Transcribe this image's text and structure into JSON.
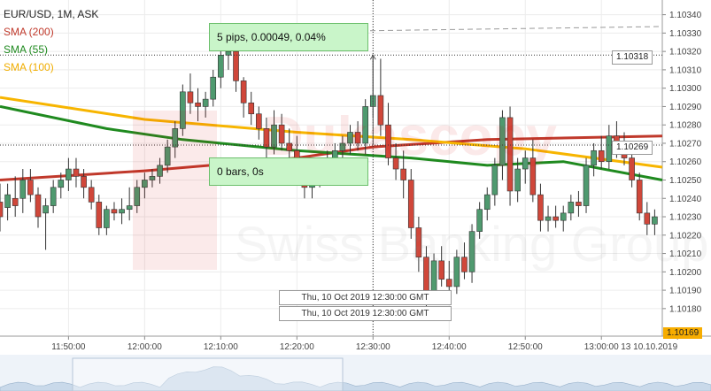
{
  "legend": {
    "instrument": "EUR/USD, 1M, ASK",
    "sma200": "SMA (200)",
    "sma55": "SMA (55)",
    "sma100": "SMA (100)"
  },
  "watermark": {
    "name": "Dukascopy",
    "sub": "Swiss Banking Group"
  },
  "measurement": {
    "top": "5 pips, 0.00049, 0.04%",
    "bottom": "0 bars, 0s"
  },
  "crosshair_time": "Thu, 10 Oct 2019 12:30:00 GMT",
  "crosshair_price": "1.10318",
  "sma_price_label": "1.10269",
  "last_price_label": "1.10169",
  "colors": {
    "bull": "#4f9a6f",
    "bear": "#d0473a",
    "sma200": "#c0392b",
    "sma55": "#1f8a1f",
    "sma100": "#f7b500"
  },
  "chart_data": {
    "type": "candlestick",
    "instrument": "EUR/USD",
    "timeframe": "1M",
    "side": "ASK",
    "x_tick_labels": [
      "11:50:00",
      "12:00:00",
      "12:10:00",
      "12:20:00",
      "12:30:00",
      "12:40:00",
      "12:50:00",
      "13:00:00",
      "13 10.10.2019"
    ],
    "y_tick_labels": [
      "1.10340",
      "1.10330",
      "1.10320",
      "1.10310",
      "1.10300",
      "1.10290",
      "1.10280",
      "1.10270",
      "1.10260",
      "1.10250",
      "1.10240",
      "1.10230",
      "1.10220",
      "1.10210",
      "1.10200",
      "1.10190",
      "1.10180"
    ],
    "ylim": [
      1.10165,
      1.10348
    ],
    "time_start": "11:41",
    "time_end": "13:08",
    "candles": [
      {
        "time": "11:41",
        "open": 1.10238,
        "high": 1.10248,
        "low": 1.10222,
        "close": 1.1023
      },
      {
        "time": "11:42",
        "open": 1.10235,
        "high": 1.10248,
        "low": 1.10228,
        "close": 1.10242
      },
      {
        "time": "11:43",
        "open": 1.1024,
        "high": 1.10252,
        "low": 1.1023,
        "close": 1.10236
      },
      {
        "time": "11:44",
        "open": 1.1024,
        "high": 1.10256,
        "low": 1.10232,
        "close": 1.1025
      },
      {
        "time": "11:45",
        "open": 1.1025,
        "high": 1.10256,
        "low": 1.10238,
        "close": 1.10242
      },
      {
        "time": "11:46",
        "open": 1.10242,
        "high": 1.10246,
        "low": 1.10224,
        "close": 1.1023
      },
      {
        "time": "11:47",
        "open": 1.10232,
        "high": 1.1024,
        "low": 1.10212,
        "close": 1.10236
      },
      {
        "time": "11:48",
        "open": 1.10236,
        "high": 1.1025,
        "low": 1.10232,
        "close": 1.10246
      },
      {
        "time": "11:49",
        "open": 1.10246,
        "high": 1.10254,
        "low": 1.1024,
        "close": 1.1025
      },
      {
        "time": "11:50",
        "open": 1.1025,
        "high": 1.10262,
        "low": 1.10244,
        "close": 1.10256
      },
      {
        "time": "11:51",
        "open": 1.10256,
        "high": 1.10262,
        "low": 1.10246,
        "close": 1.10252
      },
      {
        "time": "11:52",
        "open": 1.10252,
        "high": 1.10256,
        "low": 1.1024,
        "close": 1.10246
      },
      {
        "time": "11:53",
        "open": 1.10246,
        "high": 1.1025,
        "low": 1.10234,
        "close": 1.10238
      },
      {
        "time": "11:54",
        "open": 1.10238,
        "high": 1.10242,
        "low": 1.1022,
        "close": 1.10224
      },
      {
        "time": "11:55",
        "open": 1.10224,
        "high": 1.10236,
        "low": 1.1022,
        "close": 1.10234
      },
      {
        "time": "11:56",
        "open": 1.10234,
        "high": 1.10238,
        "low": 1.10228,
        "close": 1.10232
      },
      {
        "time": "11:57",
        "open": 1.10232,
        "high": 1.1024,
        "low": 1.10226,
        "close": 1.10234
      },
      {
        "time": "11:58",
        "open": 1.10234,
        "high": 1.10246,
        "low": 1.10228,
        "close": 1.10236
      },
      {
        "time": "11:59",
        "open": 1.10236,
        "high": 1.1025,
        "low": 1.10232,
        "close": 1.10246
      },
      {
        "time": "12:00",
        "open": 1.10246,
        "high": 1.10254,
        "low": 1.1024,
        "close": 1.1025
      },
      {
        "time": "12:01",
        "open": 1.1025,
        "high": 1.10256,
        "low": 1.10246,
        "close": 1.10252
      },
      {
        "time": "12:02",
        "open": 1.10252,
        "high": 1.10262,
        "low": 1.10248,
        "close": 1.10258
      },
      {
        "time": "12:03",
        "open": 1.10258,
        "high": 1.10272,
        "low": 1.10254,
        "close": 1.10268
      },
      {
        "time": "12:04",
        "open": 1.10268,
        "high": 1.10282,
        "low": 1.10262,
        "close": 1.10278
      },
      {
        "time": "12:05",
        "open": 1.10278,
        "high": 1.10302,
        "low": 1.10274,
        "close": 1.10298
      },
      {
        "time": "12:06",
        "open": 1.10298,
        "high": 1.10308,
        "low": 1.10286,
        "close": 1.10292
      },
      {
        "time": "12:07",
        "open": 1.10292,
        "high": 1.103,
        "low": 1.10282,
        "close": 1.1029
      },
      {
        "time": "12:08",
        "open": 1.1029,
        "high": 1.10298,
        "low": 1.10284,
        "close": 1.10294
      },
      {
        "time": "12:09",
        "open": 1.10294,
        "high": 1.1031,
        "low": 1.1029,
        "close": 1.10306
      },
      {
        "time": "12:10",
        "open": 1.10306,
        "high": 1.10324,
        "low": 1.103,
        "close": 1.10318
      },
      {
        "time": "12:11",
        "open": 1.10318,
        "high": 1.10332,
        "low": 1.1031,
        "close": 1.1032
      },
      {
        "time": "12:12",
        "open": 1.1032,
        "high": 1.10328,
        "low": 1.10298,
        "close": 1.10304
      },
      {
        "time": "12:13",
        "open": 1.10304,
        "high": 1.10306,
        "low": 1.10284,
        "close": 1.10292
      },
      {
        "time": "12:14",
        "open": 1.10292,
        "high": 1.10298,
        "low": 1.1028,
        "close": 1.10286
      },
      {
        "time": "12:15",
        "open": 1.10286,
        "high": 1.1029,
        "low": 1.10272,
        "close": 1.10278
      },
      {
        "time": "12:16",
        "open": 1.10278,
        "high": 1.10284,
        "low": 1.10262,
        "close": 1.10268
      },
      {
        "time": "12:17",
        "open": 1.10268,
        "high": 1.10288,
        "low": 1.10264,
        "close": 1.1028
      },
      {
        "time": "12:18",
        "open": 1.1028,
        "high": 1.10286,
        "low": 1.10266,
        "close": 1.1027
      },
      {
        "time": "12:19",
        "open": 1.1027,
        "high": 1.10278,
        "low": 1.1026,
        "close": 1.10266
      },
      {
        "time": "12:20",
        "open": 1.10266,
        "high": 1.10274,
        "low": 1.10248,
        "close": 1.10252
      },
      {
        "time": "12:21",
        "open": 1.10252,
        "high": 1.10256,
        "low": 1.1024,
        "close": 1.10246
      },
      {
        "time": "12:22",
        "open": 1.10246,
        "high": 1.10254,
        "low": 1.1024,
        "close": 1.1025
      },
      {
        "time": "12:23",
        "open": 1.1025,
        "high": 1.10262,
        "low": 1.10246,
        "close": 1.10258
      },
      {
        "time": "12:24",
        "open": 1.10258,
        "high": 1.10266,
        "low": 1.10252,
        "close": 1.10262
      },
      {
        "time": "12:25",
        "open": 1.10262,
        "high": 1.1027,
        "low": 1.10256,
        "close": 1.10266
      },
      {
        "time": "12:26",
        "open": 1.10266,
        "high": 1.10274,
        "low": 1.1026,
        "close": 1.1027
      },
      {
        "time": "12:27",
        "open": 1.1027,
        "high": 1.1028,
        "low": 1.10264,
        "close": 1.10276
      },
      {
        "time": "12:28",
        "open": 1.10276,
        "high": 1.10282,
        "low": 1.10266,
        "close": 1.1027
      },
      {
        "time": "12:29",
        "open": 1.1027,
        "high": 1.10294,
        "low": 1.10264,
        "close": 1.1029
      },
      {
        "time": "12:30",
        "open": 1.1029,
        "high": 1.10318,
        "low": 1.10284,
        "close": 1.10296
      },
      {
        "time": "12:31",
        "open": 1.10296,
        "high": 1.10316,
        "low": 1.10274,
        "close": 1.1028
      },
      {
        "time": "12:32",
        "open": 1.1028,
        "high": 1.10292,
        "low": 1.10258,
        "close": 1.10262
      },
      {
        "time": "12:33",
        "open": 1.10262,
        "high": 1.1027,
        "low": 1.1025,
        "close": 1.10256
      },
      {
        "time": "12:34",
        "open": 1.10256,
        "high": 1.10266,
        "low": 1.1024,
        "close": 1.1025
      },
      {
        "time": "12:35",
        "open": 1.1025,
        "high": 1.10256,
        "low": 1.10218,
        "close": 1.10224
      },
      {
        "time": "12:36",
        "open": 1.10224,
        "high": 1.1023,
        "low": 1.102,
        "close": 1.10208
      },
      {
        "time": "12:37",
        "open": 1.10208,
        "high": 1.10214,
        "low": 1.1018,
        "close": 1.10188
      },
      {
        "time": "12:38",
        "open": 1.10188,
        "high": 1.1021,
        "low": 1.10184,
        "close": 1.10206
      },
      {
        "time": "12:39",
        "open": 1.10206,
        "high": 1.10214,
        "low": 1.10192,
        "close": 1.10196
      },
      {
        "time": "12:40",
        "open": 1.10196,
        "high": 1.10206,
        "low": 1.10186,
        "close": 1.10192
      },
      {
        "time": "12:41",
        "open": 1.10192,
        "high": 1.10212,
        "low": 1.10188,
        "close": 1.10208
      },
      {
        "time": "12:42",
        "open": 1.10208,
        "high": 1.10216,
        "low": 1.10196,
        "close": 1.102
      },
      {
        "time": "12:43",
        "open": 1.102,
        "high": 1.10226,
        "low": 1.10194,
        "close": 1.10222
      },
      {
        "time": "12:44",
        "open": 1.10222,
        "high": 1.10238,
        "low": 1.10218,
        "close": 1.10234
      },
      {
        "time": "12:45",
        "open": 1.10234,
        "high": 1.10246,
        "low": 1.10228,
        "close": 1.10242
      },
      {
        "time": "12:46",
        "open": 1.10242,
        "high": 1.10262,
        "low": 1.10236,
        "close": 1.10258
      },
      {
        "time": "12:47",
        "open": 1.10258,
        "high": 1.10288,
        "low": 1.1025,
        "close": 1.10284
      },
      {
        "time": "12:48",
        "open": 1.10284,
        "high": 1.1029,
        "low": 1.10236,
        "close": 1.10244
      },
      {
        "time": "12:49",
        "open": 1.10244,
        "high": 1.10262,
        "low": 1.10238,
        "close": 1.10256
      },
      {
        "time": "12:50",
        "open": 1.10256,
        "high": 1.10266,
        "low": 1.10248,
        "close": 1.10262
      },
      {
        "time": "12:51",
        "open": 1.10262,
        "high": 1.10272,
        "low": 1.10238,
        "close": 1.10242
      },
      {
        "time": "12:52",
        "open": 1.10242,
        "high": 1.10248,
        "low": 1.10222,
        "close": 1.10228
      },
      {
        "time": "12:53",
        "open": 1.10228,
        "high": 1.10236,
        "low": 1.10222,
        "close": 1.1023
      },
      {
        "time": "12:54",
        "open": 1.1023,
        "high": 1.10236,
        "low": 1.10224,
        "close": 1.10228
      },
      {
        "time": "12:55",
        "open": 1.10228,
        "high": 1.10236,
        "low": 1.10222,
        "close": 1.10232
      },
      {
        "time": "12:56",
        "open": 1.10232,
        "high": 1.10242,
        "low": 1.10228,
        "close": 1.10238
      },
      {
        "time": "12:57",
        "open": 1.10238,
        "high": 1.10244,
        "low": 1.1023,
        "close": 1.10236
      },
      {
        "time": "12:58",
        "open": 1.10236,
        "high": 1.10262,
        "low": 1.10232,
        "close": 1.10258
      },
      {
        "time": "12:59",
        "open": 1.10258,
        "high": 1.1027,
        "low": 1.10252,
        "close": 1.10266
      },
      {
        "time": "13:00",
        "open": 1.10266,
        "high": 1.10274,
        "low": 1.10256,
        "close": 1.1026
      },
      {
        "time": "13:01",
        "open": 1.1026,
        "high": 1.1028,
        "low": 1.10256,
        "close": 1.10274
      },
      {
        "time": "13:02",
        "open": 1.10274,
        "high": 1.10282,
        "low": 1.10262,
        "close": 1.1027
      },
      {
        "time": "13:03",
        "open": 1.1027,
        "high": 1.10276,
        "low": 1.10258,
        "close": 1.10262
      },
      {
        "time": "13:04",
        "open": 1.10262,
        "high": 1.10266,
        "low": 1.10246,
        "close": 1.1025
      },
      {
        "time": "13:05",
        "open": 1.1025,
        "high": 1.10254,
        "low": 1.10228,
        "close": 1.10232
      },
      {
        "time": "13:06",
        "open": 1.10232,
        "high": 1.10238,
        "low": 1.1022,
        "close": 1.10226
      },
      {
        "time": "13:07",
        "open": 1.10226,
        "high": 1.10234,
        "low": 1.1022,
        "close": 1.1023
      }
    ],
    "sma200": [
      {
        "time": "11:41",
        "value": 1.1025
      },
      {
        "time": "12:00",
        "value": 1.10255
      },
      {
        "time": "12:20",
        "value": 1.10262
      },
      {
        "time": "12:30",
        "value": 1.10268
      },
      {
        "time": "12:45",
        "value": 1.10272
      },
      {
        "time": "13:08",
        "value": 1.10274
      }
    ],
    "sma55": [
      {
        "time": "11:41",
        "value": 1.1029
      },
      {
        "time": "11:55",
        "value": 1.10278
      },
      {
        "time": "12:05",
        "value": 1.10272
      },
      {
        "time": "12:20",
        "value": 1.10266
      },
      {
        "time": "12:35",
        "value": 1.10262
      },
      {
        "time": "12:45",
        "value": 1.10258
      },
      {
        "time": "12:55",
        "value": 1.1026
      },
      {
        "time": "13:08",
        "value": 1.1025
      }
    ],
    "sma100": [
      {
        "time": "11:41",
        "value": 1.10295
      },
      {
        "time": "12:00",
        "value": 1.10283
      },
      {
        "time": "12:20",
        "value": 1.10276
      },
      {
        "time": "12:35",
        "value": 1.10272
      },
      {
        "time": "12:50",
        "value": 1.10267
      },
      {
        "time": "13:08",
        "value": 1.10257
      }
    ],
    "crosshair": {
      "time": "12:30",
      "price": 1.10318
    },
    "measure_from_price": 1.10269,
    "grid": true
  }
}
